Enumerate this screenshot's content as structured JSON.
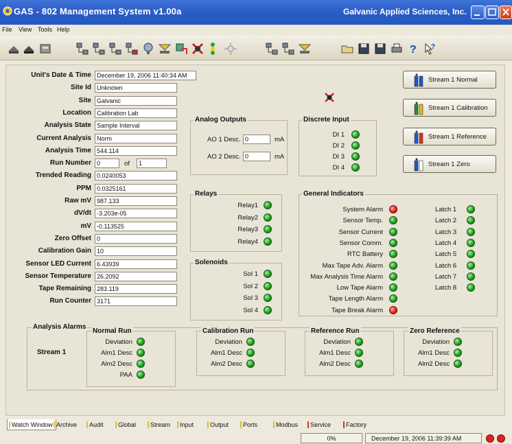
{
  "window": {
    "title": "GAS - 802 Management System  v1.00a",
    "company": "Galvanic Applied Sciences, Inc."
  },
  "menu": [
    "File",
    "View",
    "Tools",
    "Help"
  ],
  "info": [
    {
      "label": "Unit's Date & Time",
      "value": "December 19, 2006 11:40:34 AM"
    },
    {
      "label": "Site Id",
      "value": "Unknown"
    },
    {
      "label": "Site",
      "value": "Galvanic"
    },
    {
      "label": "Location",
      "value": "Calibration Lab"
    },
    {
      "label": "Analysis State",
      "value": "Sample Interval"
    },
    {
      "label": "Current Analysis",
      "value": "Norm"
    },
    {
      "label": "Analysis Time",
      "value": "544.114"
    },
    {
      "label": "Run Number",
      "value": "0"
    },
    {
      "label": "Trended Reading",
      "value": "0.0240053"
    },
    {
      "label": "PPM",
      "value": "0.0325161"
    },
    {
      "label": "Raw mV",
      "value": "987.133"
    },
    {
      "label": "dV/dt",
      "value": "-3.203e-05"
    },
    {
      "label": "mV",
      "value": "-0.113525"
    },
    {
      "label": "Zero Offset",
      "value": "0"
    },
    {
      "label": "Calibration Gain",
      "value": "10"
    },
    {
      "label": "Sensor LED Current",
      "value": "6.43939"
    },
    {
      "label": "Sensor Temperature",
      "value": "26.2092"
    },
    {
      "label": "Tape Remaining",
      "value": "283.119"
    },
    {
      "label": "Run Counter",
      "value": "3171"
    }
  ],
  "run_of": "of",
  "run_total": "1",
  "analog": {
    "title": "Analog Outputs",
    "ao1_label": "AO 1 Desc.",
    "ao1_value": "0",
    "ao2_label": "AO 2 Desc.",
    "ao2_value": "0",
    "unit": "mA"
  },
  "discrete": {
    "title": "Discrete Input",
    "items": [
      "DI 1",
      "DI 2",
      "DI 3",
      "DI 4"
    ]
  },
  "relays": {
    "title": "Relays",
    "items": [
      "Relay1",
      "Relay2",
      "Relay3",
      "Relay4"
    ]
  },
  "solenoids": {
    "title": "Solenoids",
    "items": [
      "Sol 1",
      "Sol 2",
      "Sol 3",
      "Sol 4"
    ]
  },
  "general": {
    "title": "General Indicators",
    "left": [
      {
        "label": "System Alarm",
        "status": "red"
      },
      {
        "label": "Sensor Temp.",
        "status": "green"
      },
      {
        "label": "Sensor Current",
        "status": "green"
      },
      {
        "label": "Sensor Comm.",
        "status": "green"
      },
      {
        "label": "RTC Battery",
        "status": "green"
      },
      {
        "label": "Max Tape Adv. Alarm",
        "status": "green"
      },
      {
        "label": "Max Analysis Time Alarm",
        "status": "green"
      },
      {
        "label": "Low Tape Alarm",
        "status": "green"
      },
      {
        "label": "Tape Length Alarm",
        "status": "green"
      },
      {
        "label": "Tape Break Alarm",
        "status": "red"
      }
    ],
    "right": [
      "Latch 1",
      "Latch 2",
      "Latch 3",
      "Latch 4",
      "Latch 5",
      "Latch 6",
      "Latch 7",
      "Latch 8"
    ]
  },
  "streams": [
    "Stream 1 Normal",
    "Stream 1 Calibration",
    "Stream 1 Reference",
    "Stream 1 Zero"
  ],
  "alarms": {
    "title": "Analysis Alarms",
    "stream_label": "Stream 1",
    "groups": [
      {
        "title": "Normal Run",
        "items": [
          "Deviation",
          "Alm1 Desc",
          "Alm2 Desc",
          "PAA"
        ]
      },
      {
        "title": "Calibration Run",
        "items": [
          "Deviation",
          "Alm1 Desc",
          "Alm2 Desc"
        ]
      },
      {
        "title": "Reference Run",
        "items": [
          "Deviation",
          "Alm1 Desc",
          "Alm2 Desc"
        ]
      },
      {
        "title": "Zero Reference",
        "items": [
          "Deviation",
          "Alm1 Desc",
          "Alm2 Desc"
        ]
      }
    ]
  },
  "tabs": [
    {
      "label": "Watch Window",
      "active": true
    },
    {
      "label": "Archive"
    },
    {
      "label": "Audit"
    },
    {
      "label": "Global"
    },
    {
      "label": "Stream"
    },
    {
      "label": "Input"
    },
    {
      "label": "Output"
    },
    {
      "label": "Ports"
    },
    {
      "label": "Modbus"
    },
    {
      "label": "Service",
      "mark": "#d83020"
    },
    {
      "label": "Factory",
      "mark": "#d83020"
    }
  ],
  "status": {
    "progress": "0%",
    "datetime": "December 19, 2006 11:39:39 AM"
  },
  "colors": {
    "led_green": "#1fa021",
    "led_red": "#e52416",
    "titlebar": "#2a5cc4"
  }
}
